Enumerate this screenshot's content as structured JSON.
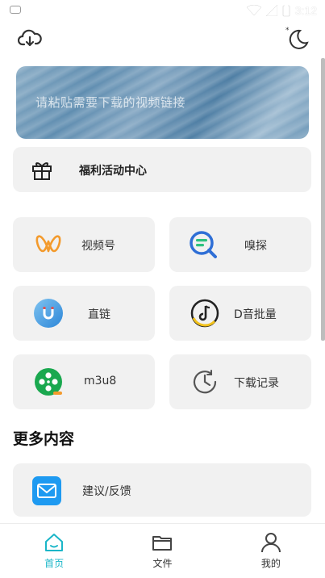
{
  "status_bar": {
    "time": "3:12"
  },
  "banner": {
    "placeholder": "请粘贴需要下载的视频链接"
  },
  "welfare": {
    "label": "福利活动中心"
  },
  "tiles": [
    {
      "label": "视频号",
      "icon": "butterfly-icon"
    },
    {
      "label": "嗅探",
      "icon": "sniff-search-icon"
    },
    {
      "label": "直链",
      "icon": "magnet-link-icon"
    },
    {
      "label": "D音批量",
      "icon": "music-note-icon"
    },
    {
      "label": "m3u8",
      "icon": "film-reel-icon"
    },
    {
      "label": "下载记录",
      "icon": "history-clock-icon"
    }
  ],
  "section": {
    "title": "更多内容"
  },
  "feedback": {
    "label": "建议/反馈",
    "icon": "mail-icon"
  },
  "nav": [
    {
      "label": "首页",
      "icon": "home-icon",
      "active": true
    },
    {
      "label": "文件",
      "icon": "folder-icon",
      "active": false
    },
    {
      "label": "我的",
      "icon": "profile-icon",
      "active": false
    }
  ],
  "colors": {
    "accent": "#1bb6c8",
    "card": "#f1f1f1"
  }
}
